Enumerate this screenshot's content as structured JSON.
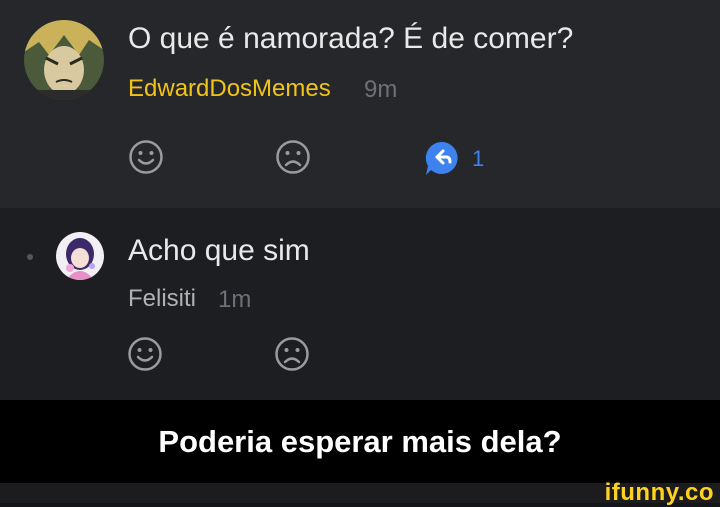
{
  "comment": {
    "text": "O que é namorada? É de comer?",
    "author": "EdwardDosMemes",
    "time": "9m",
    "author_color": "#f0c419",
    "reply_count": "1",
    "reply_color": "#3d82ef"
  },
  "reply": {
    "text": "Acho que sim",
    "author": "Felisiti",
    "time": "1m",
    "author_color": "#b0b1b5"
  },
  "caption": "Poderia esperar mais dela?",
  "watermark": "ifunny.co",
  "icons": [
    "smile-icon",
    "frown-icon",
    "reply-icon"
  ]
}
